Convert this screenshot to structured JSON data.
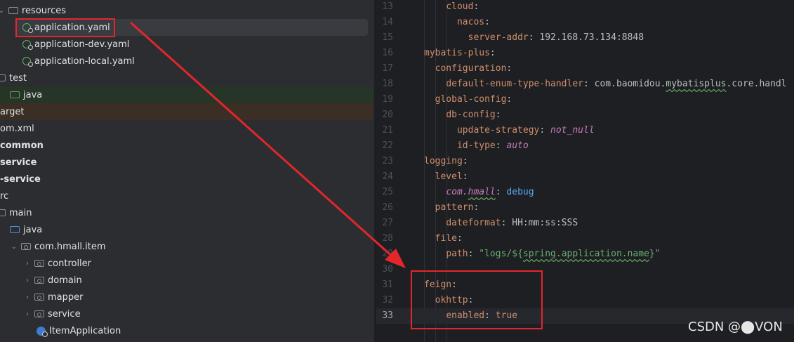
{
  "tree": {
    "items": [
      {
        "label": "resources",
        "icon": "folder-icon"
      },
      {
        "label": "application.yaml",
        "icon": "yaml-icon"
      },
      {
        "label": "application-dev.yaml",
        "icon": "yaml-icon"
      },
      {
        "label": "application-local.yaml",
        "icon": "yaml-icon"
      },
      {
        "label": "test",
        "icon": "folder-icon"
      },
      {
        "label": "java",
        "icon": "folder-green-icon"
      },
      {
        "label": "arget",
        "icon": "none"
      },
      {
        "label": "om.xml",
        "icon": "none"
      },
      {
        "label": "common",
        "icon": "none"
      },
      {
        "label": "service",
        "icon": "none"
      },
      {
        "label": "-service",
        "icon": "none"
      },
      {
        "label": "rc",
        "icon": "none"
      },
      {
        "label": "main",
        "icon": "folder-icon"
      },
      {
        "label": "java",
        "icon": "folder-blue-icon"
      },
      {
        "label": "com.hmall.item",
        "icon": "package-icon"
      },
      {
        "label": "controller",
        "icon": "package-icon"
      },
      {
        "label": "domain",
        "icon": "package-icon"
      },
      {
        "label": "mapper",
        "icon": "package-icon"
      },
      {
        "label": "service",
        "icon": "package-icon"
      },
      {
        "label": "ItemApplication",
        "icon": "class-icon"
      }
    ]
  },
  "editor": {
    "lines": [
      {
        "no": "13",
        "tokens": [
          {
            "t": "    ",
            "c": "p"
          },
          {
            "t": "cloud",
            "c": "k"
          },
          {
            "t": ":",
            "c": "p"
          }
        ]
      },
      {
        "no": "14",
        "tokens": [
          {
            "t": "      ",
            "c": "p"
          },
          {
            "t": "nacos",
            "c": "k"
          },
          {
            "t": ":",
            "c": "p"
          }
        ]
      },
      {
        "no": "15",
        "tokens": [
          {
            "t": "        ",
            "c": "p"
          },
          {
            "t": "server-addr",
            "c": "k"
          },
          {
            "t": ": 192.168.73.134:8848",
            "c": "p"
          }
        ]
      },
      {
        "no": "16",
        "tokens": [
          {
            "t": "mybatis-plus",
            "c": "k"
          },
          {
            "t": ":",
            "c": "p"
          }
        ]
      },
      {
        "no": "17",
        "tokens": [
          {
            "t": "  ",
            "c": "p"
          },
          {
            "t": "configuration",
            "c": "k"
          },
          {
            "t": ":",
            "c": "p"
          }
        ]
      },
      {
        "no": "18",
        "tokens": [
          {
            "t": "    ",
            "c": "p"
          },
          {
            "t": "default-enum-type-handler",
            "c": "k"
          },
          {
            "t": ": com.baomidou.",
            "c": "p"
          },
          {
            "t": "mybatisplus",
            "c": "p wav"
          },
          {
            "t": ".core.handl",
            "c": "p"
          }
        ]
      },
      {
        "no": "19",
        "tokens": [
          {
            "t": "  ",
            "c": "p"
          },
          {
            "t": "global-config",
            "c": "k"
          },
          {
            "t": ":",
            "c": "p"
          }
        ]
      },
      {
        "no": "20",
        "tokens": [
          {
            "t": "    ",
            "c": "p"
          },
          {
            "t": "db-config",
            "c": "k"
          },
          {
            "t": ":",
            "c": "p"
          }
        ]
      },
      {
        "no": "21",
        "tokens": [
          {
            "t": "      ",
            "c": "p"
          },
          {
            "t": "update-strategy",
            "c": "k"
          },
          {
            "t": ": ",
            "c": "p"
          },
          {
            "t": "not_null",
            "c": "it"
          }
        ]
      },
      {
        "no": "22",
        "tokens": [
          {
            "t": "      ",
            "c": "p"
          },
          {
            "t": "id-type",
            "c": "k"
          },
          {
            "t": ": ",
            "c": "p"
          },
          {
            "t": "auto",
            "c": "it"
          }
        ]
      },
      {
        "no": "23",
        "tokens": [
          {
            "t": "logging",
            "c": "k"
          },
          {
            "t": ":",
            "c": "p"
          }
        ]
      },
      {
        "no": "24",
        "tokens": [
          {
            "t": "  ",
            "c": "p"
          },
          {
            "t": "level",
            "c": "k"
          },
          {
            "t": ":",
            "c": "p"
          }
        ]
      },
      {
        "no": "25",
        "tokens": [
          {
            "t": "    ",
            "c": "p"
          },
          {
            "t": "com.",
            "c": "k it"
          },
          {
            "t": "hmall",
            "c": "k it wav"
          },
          {
            "t": ": ",
            "c": "p"
          },
          {
            "t": "debug",
            "c": "deb"
          }
        ]
      },
      {
        "no": "26",
        "tokens": [
          {
            "t": "  ",
            "c": "p"
          },
          {
            "t": "pattern",
            "c": "k"
          },
          {
            "t": ":",
            "c": "p"
          }
        ]
      },
      {
        "no": "27",
        "tokens": [
          {
            "t": "    ",
            "c": "p"
          },
          {
            "t": "dateformat",
            "c": "k"
          },
          {
            "t": ": HH:mm:ss:SSS",
            "c": "p"
          }
        ]
      },
      {
        "no": "28",
        "tokens": [
          {
            "t": "  ",
            "c": "p"
          },
          {
            "t": "file",
            "c": "k"
          },
          {
            "t": ":",
            "c": "p"
          }
        ]
      },
      {
        "no": "29",
        "tokens": [
          {
            "t": "    ",
            "c": "p"
          },
          {
            "t": "path",
            "c": "k"
          },
          {
            "t": ": ",
            "c": "p"
          },
          {
            "t": "\"logs/${",
            "c": "s"
          },
          {
            "t": "spring.application.name",
            "c": "s wav"
          },
          {
            "t": "}\"",
            "c": "s"
          }
        ]
      },
      {
        "no": "30",
        "tokens": []
      },
      {
        "no": "31",
        "tokens": [
          {
            "t": "feign",
            "c": "k"
          },
          {
            "t": ":",
            "c": "p"
          }
        ]
      },
      {
        "no": "32",
        "tokens": [
          {
            "t": "  ",
            "c": "p"
          },
          {
            "t": "okhttp",
            "c": "k"
          },
          {
            "t": ":",
            "c": "p"
          }
        ]
      },
      {
        "no": "33",
        "tokens": [
          {
            "t": "    ",
            "c": "p"
          },
          {
            "t": "enabled",
            "c": "k"
          },
          {
            "t": ": ",
            "c": "p"
          },
          {
            "t": "true",
            "c": "kw"
          }
        ]
      }
    ],
    "current_line": "33"
  },
  "watermark": "CSDN @⬤VON",
  "colors": {
    "annotation": "#e3262b",
    "background": "#1e1f22",
    "panel": "#2b2d30"
  }
}
